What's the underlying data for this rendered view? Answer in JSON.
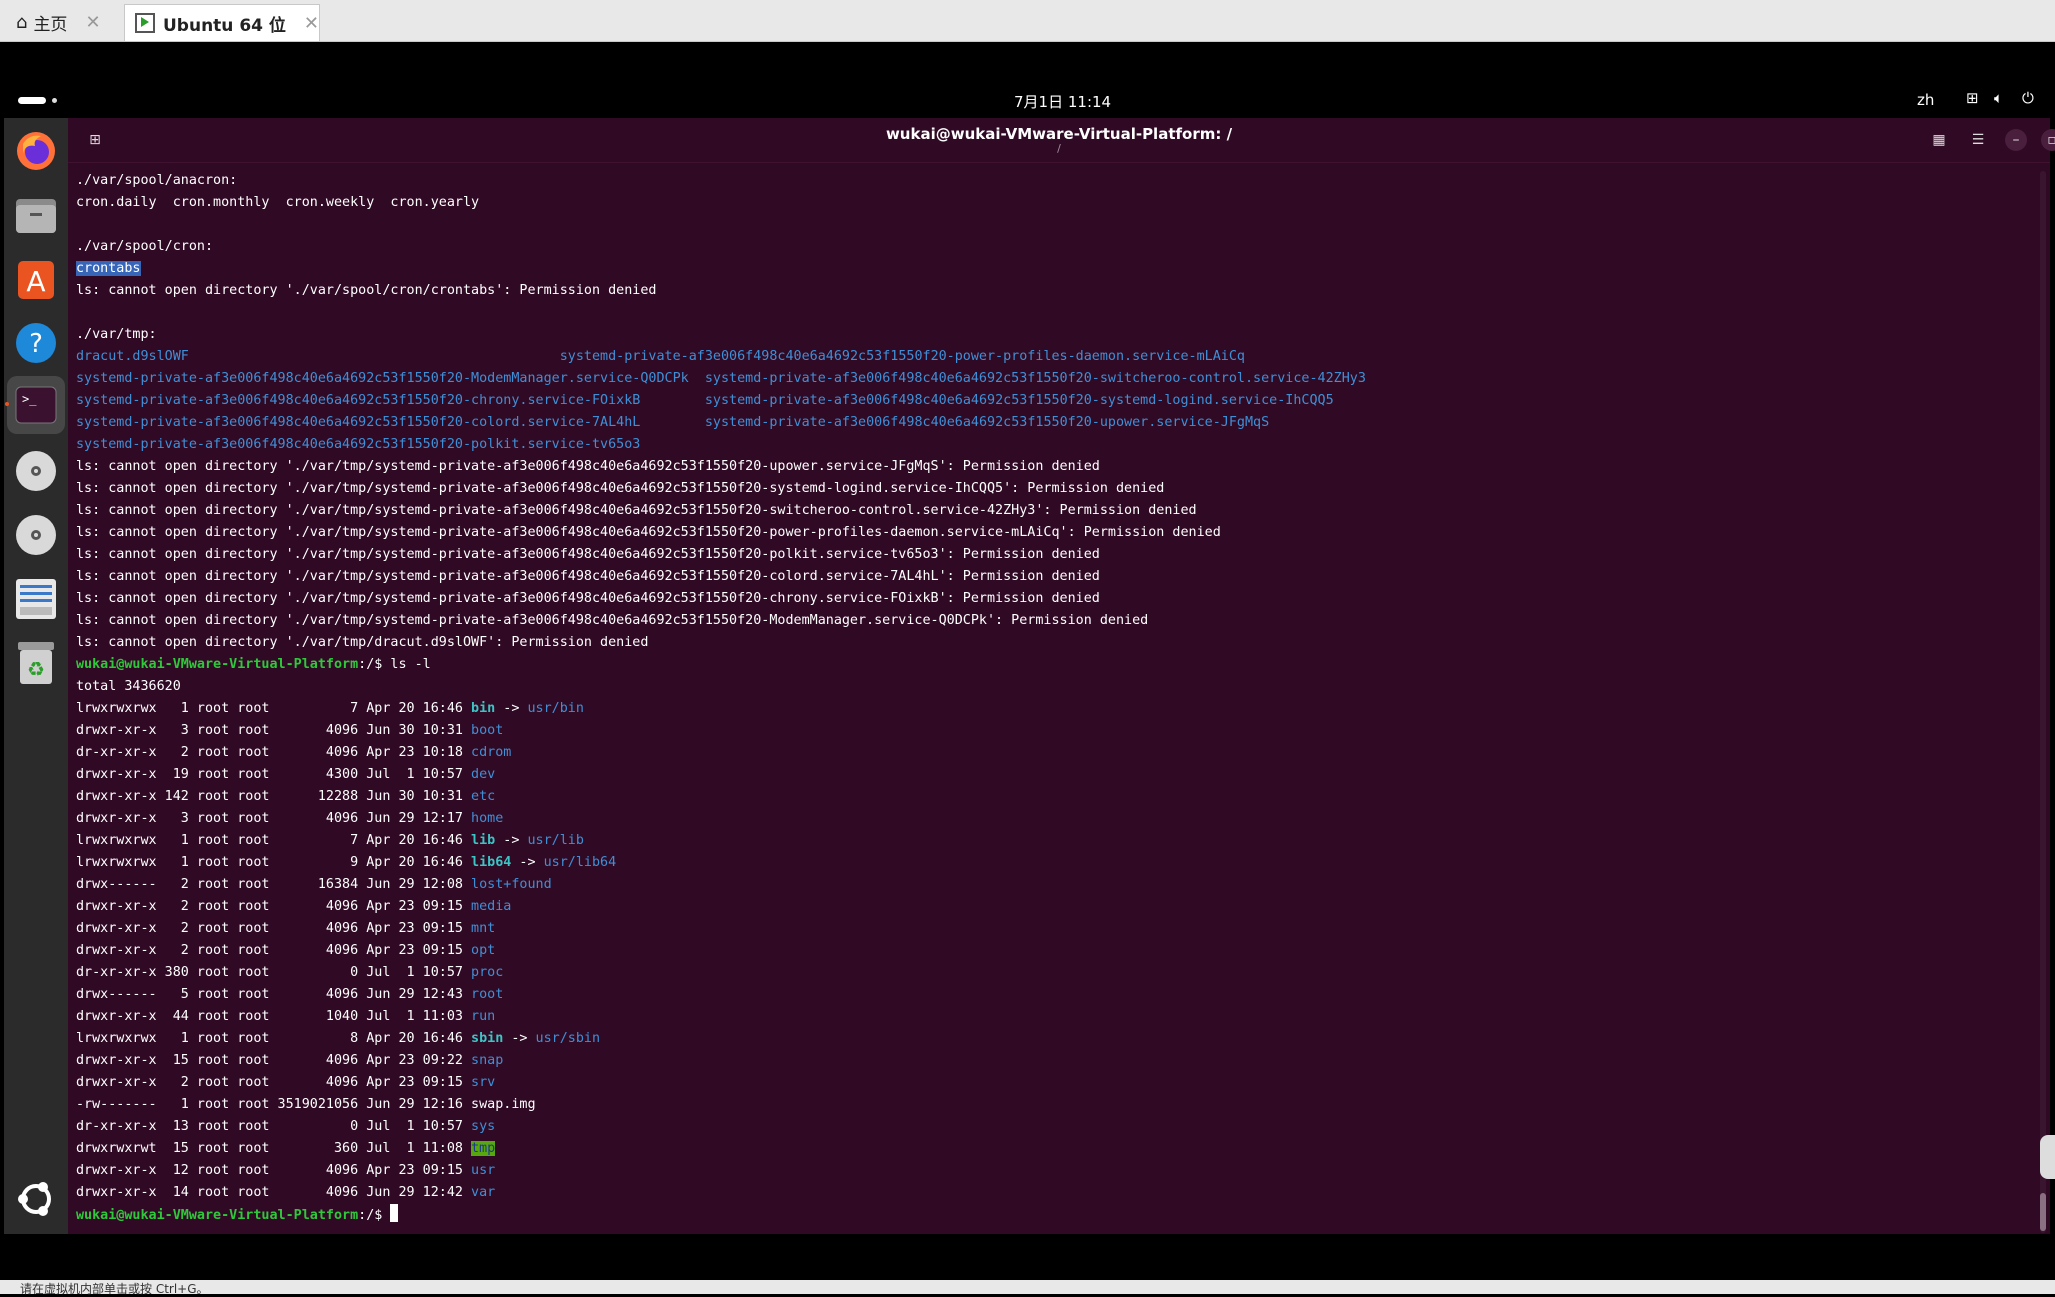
{
  "vmware": {
    "tabs": [
      {
        "label": "主页",
        "icon": "home-icon"
      },
      {
        "label": "Ubuntu 64 位",
        "icon": "vm-play-icon"
      }
    ],
    "status_text": "请在虚拟机内部单击或按 Ctrl+G。"
  },
  "topbar": {
    "clock": "7月1日  11:14",
    "lang": "zh"
  },
  "dock": {
    "items": [
      "firefox-icon",
      "files-icon",
      "app-center-icon",
      "help-icon",
      "terminal-icon",
      "disc-icon",
      "disc-icon",
      "document-icon",
      "trash-icon",
      "ubuntu-icon"
    ]
  },
  "terminal": {
    "title": "wukai@wukai-VMware-Virtual-Platform: /",
    "subtitle": "/",
    "header_buttons": [
      "new-tab-icon",
      "grid-icon",
      "menu-icon",
      "minimize-icon",
      "restore-icon",
      "close-icon"
    ],
    "lines": [
      [
        {
          "t": "./var/spool/anacron:"
        }
      ],
      [
        {
          "t": "cron.daily  cron.monthly  cron.weekly  cron.yearly"
        }
      ],
      [
        {
          "t": ""
        }
      ],
      [
        {
          "t": "./var/spool/cron:"
        }
      ],
      [
        {
          "t": "crontabs",
          "c": "sel"
        }
      ],
      [
        {
          "t": "ls: cannot open directory './var/spool/cron/crontabs': Permission denied"
        }
      ],
      [
        {
          "t": ""
        }
      ],
      [
        {
          "t": "./var/tmp:"
        }
      ],
      [
        {
          "t": "dracut.d9slOWF                                              ",
          "c": "dir"
        },
        {
          "t": "systemd-private-af3e006f498c40e6a4692c53f1550f20-power-profiles-daemon.service-mLAiCq",
          "c": "dir"
        }
      ],
      [
        {
          "t": "systemd-private-af3e006f498c40e6a4692c53f1550f20-ModemManager.service-Q0DCPk",
          "c": "dir"
        },
        {
          "t": "  "
        },
        {
          "t": "systemd-private-af3e006f498c40e6a4692c53f1550f20-switcheroo-control.service-42ZHy3",
          "c": "dir"
        }
      ],
      [
        {
          "t": "systemd-private-af3e006f498c40e6a4692c53f1550f20-chrony.service-FOixkB",
          "c": "dir"
        },
        {
          "t": "        "
        },
        {
          "t": "systemd-private-af3e006f498c40e6a4692c53f1550f20-systemd-logind.service-IhCQQ5",
          "c": "dir"
        }
      ],
      [
        {
          "t": "systemd-private-af3e006f498c40e6a4692c53f1550f20-colord.service-7AL4hL",
          "c": "dir"
        },
        {
          "t": "        "
        },
        {
          "t": "systemd-private-af3e006f498c40e6a4692c53f1550f20-upower.service-JFgMqS",
          "c": "dir"
        }
      ],
      [
        {
          "t": "systemd-private-af3e006f498c40e6a4692c53f1550f20-polkit.service-tv65o3",
          "c": "dir"
        }
      ],
      [
        {
          "t": "ls: cannot open directory './var/tmp/systemd-private-af3e006f498c40e6a4692c53f1550f20-upower.service-JFgMqS': Permission denied"
        }
      ],
      [
        {
          "t": "ls: cannot open directory './var/tmp/systemd-private-af3e006f498c40e6a4692c53f1550f20-systemd-logind.service-IhCQQ5': Permission denied"
        }
      ],
      [
        {
          "t": "ls: cannot open directory './var/tmp/systemd-private-af3e006f498c40e6a4692c53f1550f20-switcheroo-control.service-42ZHy3': Permission denied"
        }
      ],
      [
        {
          "t": "ls: cannot open directory './var/tmp/systemd-private-af3e006f498c40e6a4692c53f1550f20-power-profiles-daemon.service-mLAiCq': Permission denied"
        }
      ],
      [
        {
          "t": "ls: cannot open directory './var/tmp/systemd-private-af3e006f498c40e6a4692c53f1550f20-polkit.service-tv65o3': Permission denied"
        }
      ],
      [
        {
          "t": "ls: cannot open directory './var/tmp/systemd-private-af3e006f498c40e6a4692c53f1550f20-colord.service-7AL4hL': Permission denied"
        }
      ],
      [
        {
          "t": "ls: cannot open directory './var/tmp/systemd-private-af3e006f498c40e6a4692c53f1550f20-chrony.service-FOixkB': Permission denied"
        }
      ],
      [
        {
          "t": "ls: cannot open directory './var/tmp/systemd-private-af3e006f498c40e6a4692c53f1550f20-ModemManager.service-Q0DCPk': Permission denied"
        }
      ],
      [
        {
          "t": "ls: cannot open directory './var/tmp/dracut.d9slOWF': Permission denied"
        }
      ],
      [
        {
          "t": "wukai@wukai-VMware-Virtual-Platform",
          "c": "prompt"
        },
        {
          "t": ":/$ ls -l"
        }
      ],
      [
        {
          "t": "total 3436620"
        }
      ],
      [
        {
          "t": "lrwxrwxrwx   1 root root          7 Apr 20 16:46 "
        },
        {
          "t": "bin",
          "c": "link"
        },
        {
          "t": " -> "
        },
        {
          "t": "usr/bin",
          "c": "dir"
        }
      ],
      [
        {
          "t": "drwxr-xr-x   3 root root       4096 Jun 30 10:31 "
        },
        {
          "t": "boot",
          "c": "dir"
        }
      ],
      [
        {
          "t": "dr-xr-xr-x   2 root root       4096 Apr 23 10:18 "
        },
        {
          "t": "cdrom",
          "c": "dir"
        }
      ],
      [
        {
          "t": "drwxr-xr-x  19 root root       4300 Jul  1 10:57 "
        },
        {
          "t": "dev",
          "c": "dir"
        }
      ],
      [
        {
          "t": "drwxr-xr-x 142 root root      12288 Jun 30 10:31 "
        },
        {
          "t": "etc",
          "c": "dir"
        }
      ],
      [
        {
          "t": "drwxr-xr-x   3 root root       4096 Jun 29 12:17 "
        },
        {
          "t": "home",
          "c": "dir"
        }
      ],
      [
        {
          "t": "lrwxrwxrwx   1 root root          7 Apr 20 16:46 "
        },
        {
          "t": "lib",
          "c": "link"
        },
        {
          "t": " -> "
        },
        {
          "t": "usr/lib",
          "c": "dir"
        }
      ],
      [
        {
          "t": "lrwxrwxrwx   1 root root          9 Apr 20 16:46 "
        },
        {
          "t": "lib64",
          "c": "link"
        },
        {
          "t": " -> "
        },
        {
          "t": "usr/lib64",
          "c": "dir"
        }
      ],
      [
        {
          "t": "drwx------   2 root root      16384 Jun 29 12:08 "
        },
        {
          "t": "lost+found",
          "c": "dir"
        }
      ],
      [
        {
          "t": "drwxr-xr-x   2 root root       4096 Apr 23 09:15 "
        },
        {
          "t": "media",
          "c": "dir"
        }
      ],
      [
        {
          "t": "drwxr-xr-x   2 root root       4096 Apr 23 09:15 "
        },
        {
          "t": "mnt",
          "c": "dir"
        }
      ],
      [
        {
          "t": "drwxr-xr-x   2 root root       4096 Apr 23 09:15 "
        },
        {
          "t": "opt",
          "c": "dir"
        }
      ],
      [
        {
          "t": "dr-xr-xr-x 380 root root          0 Jul  1 10:57 "
        },
        {
          "t": "proc",
          "c": "dir"
        }
      ],
      [
        {
          "t": "drwx------   5 root root       4096 Jun 29 12:43 "
        },
        {
          "t": "root",
          "c": "dir"
        }
      ],
      [
        {
          "t": "drwxr-xr-x  44 root root       1040 Jul  1 11:03 "
        },
        {
          "t": "run",
          "c": "dir"
        }
      ],
      [
        {
          "t": "lrwxrwxrwx   1 root root          8 Apr 20 16:46 "
        },
        {
          "t": "sbin",
          "c": "link"
        },
        {
          "t": " -> "
        },
        {
          "t": "usr/sbin",
          "c": "dir"
        }
      ],
      [
        {
          "t": "drwxr-xr-x  15 root root       4096 Apr 23 09:22 "
        },
        {
          "t": "snap",
          "c": "dir"
        }
      ],
      [
        {
          "t": "drwxr-xr-x   2 root root       4096 Apr 23 09:15 "
        },
        {
          "t": "srv",
          "c": "dir"
        }
      ],
      [
        {
          "t": "-rw-------   1 root root 3519021056 Jun 29 12:16 swap.img"
        }
      ],
      [
        {
          "t": "dr-xr-xr-x  13 root root          0 Jul  1 10:57 "
        },
        {
          "t": "sys",
          "c": "dir"
        }
      ],
      [
        {
          "t": "drwxrwxrwt  15 root root        360 Jul  1 11:08 "
        },
        {
          "t": "tmp",
          "c": "sticky"
        }
      ],
      [
        {
          "t": "drwxr-xr-x  12 root root       4096 Apr 23 09:15 "
        },
        {
          "t": "usr",
          "c": "dir"
        }
      ],
      [
        {
          "t": "drwxr-xr-x  14 root root       4096 Jun 29 12:42 "
        },
        {
          "t": "var",
          "c": "dir"
        }
      ],
      [
        {
          "t": "wukai@wukai-VMware-Virtual-Platform",
          "c": "prompt"
        },
        {
          "t": ":/$ "
        },
        {
          "t": "",
          "c": "cursor"
        }
      ]
    ]
  },
  "colors": {
    "terminal_bg": "#300a24",
    "directory": "#3f8fd6",
    "prompt": "#2ec93a",
    "symlink": "#3cc5c5",
    "sticky_bg": "#56a80e",
    "selection_bg": "#3765b8",
    "accent": "#e95420"
  }
}
